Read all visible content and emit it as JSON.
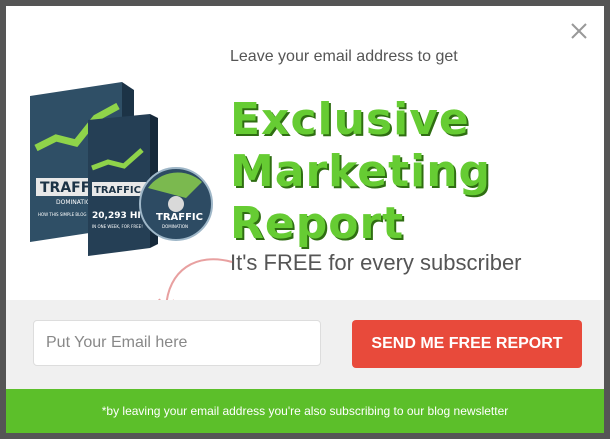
{
  "modal": {
    "intro_text": "Leave your email address to get",
    "headline": [
      "Exclusive",
      "Marketing",
      "Report"
    ],
    "subheadline": "It's FREE for every subscriber",
    "product_image": {
      "title": "TRAFFIC",
      "subtitle": "DOMINATION",
      "blurb_line1": "HOW THIS SIMPLE BLOG POST GOT",
      "stat": "20,293 HITS",
      "blurb_line2": "IN ONE WEEK, FOR FREE!",
      "disc_title": "TRAFFIC",
      "disc_subtitle": "DOMINATION"
    },
    "form": {
      "email_placeholder": "Put Your Email here",
      "email_value": "",
      "submit_label": "SEND ME FREE REPORT"
    },
    "footer_note": "*by leaving your email address you're also subscribing to our blog newsletter",
    "colors": {
      "accent_green": "#66cc33",
      "footer_green": "#5cbf2a",
      "button_red": "#e84a3b"
    },
    "icons": {
      "close": "close-icon",
      "arrow": "curved-arrow-icon"
    }
  }
}
